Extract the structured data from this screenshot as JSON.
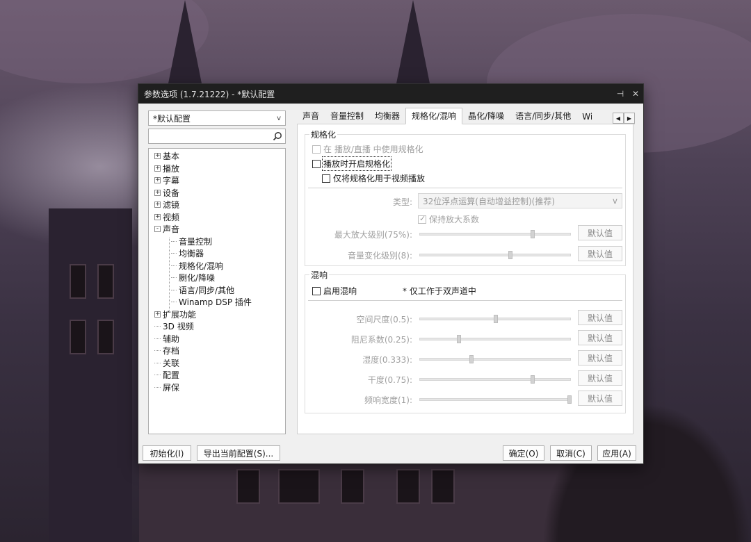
{
  "window": {
    "title": "参数选项 (1.7.21222) - *默认配置",
    "pin_glyph": "⊣",
    "close_glyph": "✕"
  },
  "profile": {
    "selected": "*默认配置",
    "arrow": "v"
  },
  "search": {
    "placeholder": "",
    "icon": "search-icon"
  },
  "tree": {
    "nodes": [
      {
        "label": "基本",
        "expander": "+"
      },
      {
        "label": "播放",
        "expander": "+"
      },
      {
        "label": "字幕",
        "expander": "+"
      },
      {
        "label": "设备",
        "expander": "+"
      },
      {
        "label": "滤镜",
        "expander": "+"
      },
      {
        "label": "视频",
        "expander": "+"
      },
      {
        "label": "声音",
        "expander": "-"
      },
      {
        "label": "音量控制"
      },
      {
        "label": "均衡器"
      },
      {
        "label": "规格化/混响"
      },
      {
        "label": "劂化/降噪"
      },
      {
        "label": "语言/同步/其他"
      },
      {
        "label": "Winamp DSP 插件"
      },
      {
        "label": "扩展功能",
        "expander": "+"
      },
      {
        "label": "3D 视频"
      },
      {
        "label": "辅助"
      },
      {
        "label": "存档"
      },
      {
        "label": "关联"
      },
      {
        "label": "配置"
      },
      {
        "label": "屏保"
      }
    ]
  },
  "tabs": [
    "声音",
    "音量控制",
    "均衡器",
    "规格化/混响",
    "晶化/降噪",
    "语言/同步/其他",
    "Wi"
  ],
  "tab_scroll": {
    "left": "◀",
    "right": "▶"
  },
  "normalize": {
    "legend": "规格化",
    "opt_use_in": "在 播放/直播 中使用规格化",
    "opt_enable": "播放时开启规格化",
    "opt_video_only": "仅将规格化用于视频播放",
    "type_label": "类型:",
    "type_value": "32位浮点运算(自动增益控制)(推荐)",
    "type_arrow": "v",
    "keep_gain": "保持放大系数",
    "max_gain_label": "最大放大级别(75%):",
    "vol_change_label": "音量变化级别(8):",
    "default_btn": "默认值"
  },
  "reverb": {
    "legend": "混响",
    "enable": "启用混响",
    "note": "* 仅工作于双声道中",
    "rows": [
      {
        "label": "空间尺度(0.5):",
        "value": 0.5,
        "btn": "默认值"
      },
      {
        "label": "阻尼系数(0.25):",
        "value": 0.25,
        "btn": "默认值"
      },
      {
        "label": "湿度(0.333):",
        "value": 0.333,
        "btn": "默认值"
      },
      {
        "label": "干度(0.75):",
        "value": 0.75,
        "btn": "默认值"
      },
      {
        "label": "频响宽度(1):",
        "value": 1,
        "btn": "默认值"
      }
    ]
  },
  "sliders": {
    "max_gain": 0.75,
    "vol_change": 0.6
  },
  "footer": {
    "init": "初始化(I)",
    "export": "导出当前配置(S)...",
    "ok": "确定(O)",
    "cancel": "取消(C)",
    "apply": "应用(A)"
  }
}
